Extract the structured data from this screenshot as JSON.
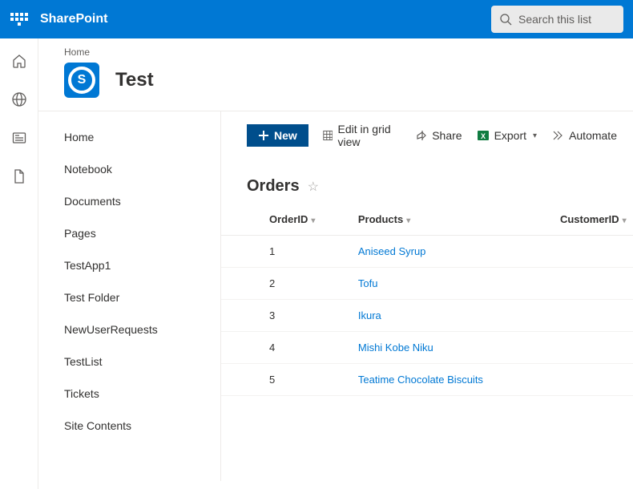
{
  "header": {
    "app_name": "SharePoint",
    "search_placeholder": "Search this list"
  },
  "rail_icons": [
    "home-icon",
    "globe-icon",
    "news-icon",
    "file-icon"
  ],
  "site": {
    "breadcrumb": "Home",
    "title": "Test",
    "logo_letter": "S"
  },
  "nav": {
    "items": [
      {
        "label": "Home"
      },
      {
        "label": "Notebook"
      },
      {
        "label": "Documents"
      },
      {
        "label": "Pages"
      },
      {
        "label": "TestApp1"
      },
      {
        "label": "Test Folder"
      },
      {
        "label": "NewUserRequests"
      },
      {
        "label": "TestList"
      },
      {
        "label": "Tickets"
      },
      {
        "label": "Site Contents"
      }
    ]
  },
  "command_bar": {
    "new_label": "New",
    "edit_grid_label": "Edit in grid view",
    "share_label": "Share",
    "export_label": "Export",
    "automate_label": "Automate"
  },
  "list": {
    "title": "Orders",
    "columns": [
      "OrderID",
      "Products",
      "CustomerID"
    ],
    "rows": [
      {
        "OrderID": "1",
        "Products": "Aniseed Syrup",
        "CustomerID": ""
      },
      {
        "OrderID": "2",
        "Products": "Tofu",
        "CustomerID": ""
      },
      {
        "OrderID": "3",
        "Products": "Ikura",
        "CustomerID": ""
      },
      {
        "OrderID": "4",
        "Products": "Mishi Kobe Niku",
        "CustomerID": ""
      },
      {
        "OrderID": "5",
        "Products": "Teatime Chocolate Biscuits",
        "CustomerID": ""
      }
    ]
  },
  "colors": {
    "brand": "#0078d4",
    "new_button": "#004e8c",
    "link": "#0078d4"
  }
}
